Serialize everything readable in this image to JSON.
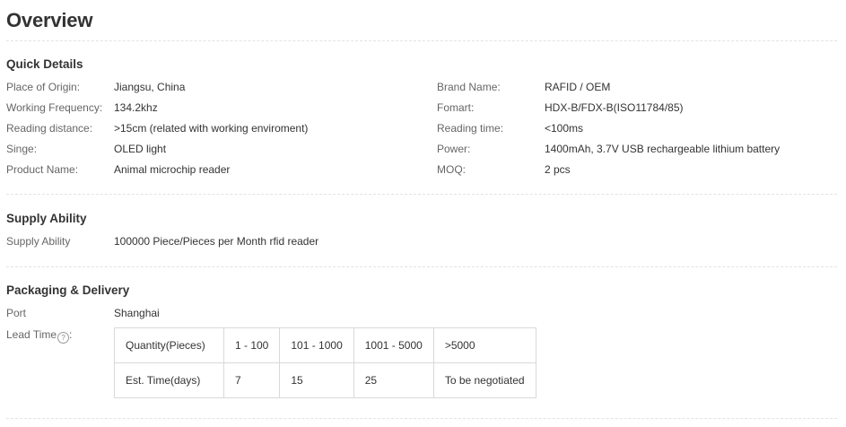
{
  "overview": {
    "title": "Overview"
  },
  "quick_details": {
    "title": "Quick Details",
    "left": [
      {
        "label": "Place of Origin:",
        "value": "Jiangsu, China"
      },
      {
        "label": "Working Frequency:",
        "value": "134.2khz"
      },
      {
        "label": "Reading distance:",
        "value": ">15cm (related with working enviroment)"
      },
      {
        "label": "Singe:",
        "value": "OLED light"
      },
      {
        "label": "Product Name:",
        "value": "Animal microchip reader"
      }
    ],
    "right": [
      {
        "label": "Brand Name:",
        "value": "RAFID / OEM"
      },
      {
        "label": "Fomart:",
        "value": "HDX-B/FDX-B(ISO11784/85)"
      },
      {
        "label": "Reading time:",
        "value": "<100ms"
      },
      {
        "label": "Power:",
        "value": "1400mAh, 3.7V USB rechargeable lithium battery"
      },
      {
        "label": "MOQ:",
        "value": "2 pcs"
      }
    ]
  },
  "supply_ability": {
    "title": "Supply Ability",
    "label": "Supply Ability",
    "value": "100000 Piece/Pieces per Month rfid reader"
  },
  "packaging": {
    "title": "Packaging & Delivery",
    "port_label": "Port",
    "port_value": "Shanghai",
    "lead_time_label": "Lead Time",
    "help_icon_glyph": "?",
    "lead_table": {
      "header": [
        "Quantity(Pieces)",
        "1 - 100",
        "101 - 1000",
        "1001 - 5000",
        ">5000"
      ],
      "row": [
        "Est. Time(days)",
        "7",
        "15",
        "25",
        "To be negotiated"
      ]
    }
  }
}
